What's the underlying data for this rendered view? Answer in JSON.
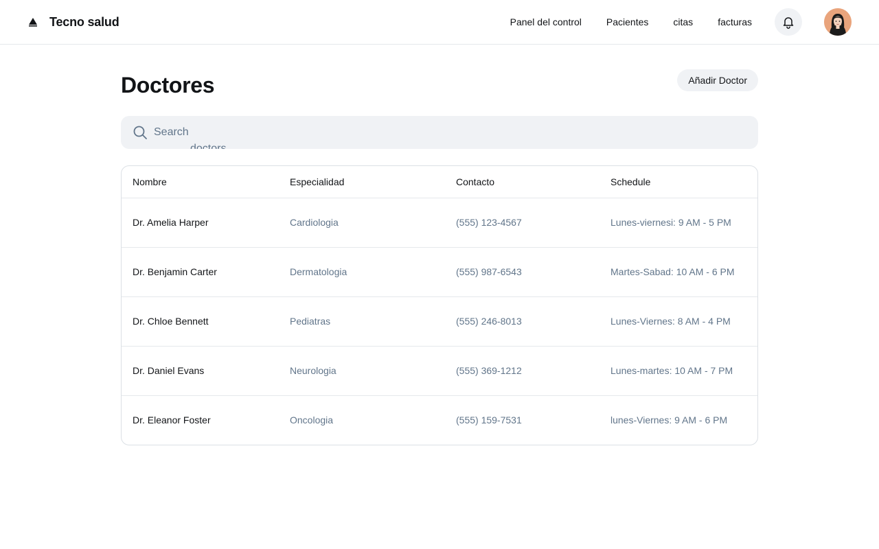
{
  "header": {
    "brand": "Tecno salud",
    "nav": [
      "Panel del control",
      "Pacientes",
      "citas",
      "facturas"
    ],
    "icons": {
      "logo": "triangle-logo-icon",
      "notifications": "bell-icon"
    }
  },
  "page": {
    "title": "Doctores",
    "add_button": "Añadir Doctor"
  },
  "search": {
    "placeholder": "Search",
    "overflow_text": "doctors"
  },
  "table": {
    "columns": [
      "Nombre",
      "Especialidad",
      "Contacto",
      "Schedule"
    ],
    "rows": [
      [
        "Dr. Amelia Harper",
        "Cardiologia",
        "(555) 123-4567",
        "Lunes-viernesi: 9 AM - 5 PM"
      ],
      [
        "Dr. Benjamin Carter",
        "Dermatologia",
        "(555) 987-6543",
        "Martes-Sabad: 10 AM - 6 PM"
      ],
      [
        "Dr. Chloe Bennett",
        "Pediatras",
        "(555) 246-8013",
        "Lunes-Viernes: 8 AM - 4 PM"
      ],
      [
        "Dr. Daniel Evans",
        "Neurologia",
        "(555) 369-1212",
        "Lunes-martes: 10 AM - 7 PM"
      ],
      [
        "Dr. Eleanor Foster",
        "Oncologia",
        "(555) 159-7531",
        "lunes-Viernes: 9 AM - 6 PM"
      ]
    ]
  },
  "colors": {
    "text_primary": "#121417",
    "text_secondary": "#61758a",
    "surface": "#f0f2f5",
    "border": "#dbe0e5",
    "avatar_bg": "#e9a47c"
  }
}
